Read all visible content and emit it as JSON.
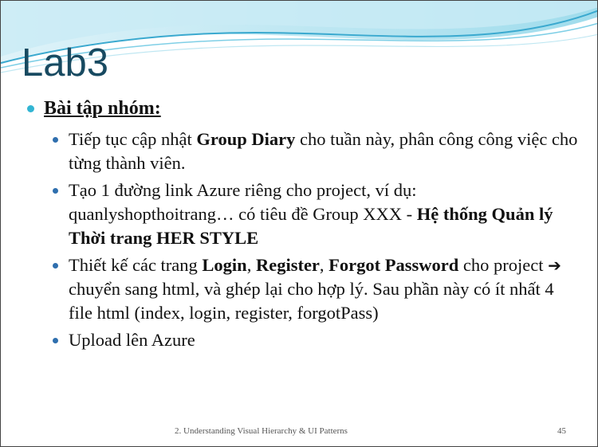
{
  "title": "Lab3",
  "section": {
    "label": "Bài tập nhóm:"
  },
  "bullets": [
    {
      "parts": [
        {
          "t": "Tiếp tục cập nhật "
        },
        {
          "t": "Group Diary",
          "b": true
        },
        {
          "t": " cho tuần này, phân công công việc cho từng thành viên."
        }
      ]
    },
    {
      "parts": [
        {
          "t": "Tạo 1 đường link Azure riêng cho project, ví dụ: quanlyshopthoitrang… có tiêu đề Group XXX - "
        },
        {
          "t": "Hệ thống Quản lý Thời trang HER STYLE",
          "b": true
        }
      ]
    },
    {
      "parts": [
        {
          "t": "Thiết kế các trang "
        },
        {
          "t": "Login",
          "b": true
        },
        {
          "t": ", "
        },
        {
          "t": "Register",
          "b": true
        },
        {
          "t": ", "
        },
        {
          "t": "Forgot Password",
          "b": true
        },
        {
          "t": " cho project "
        },
        {
          "t": "➔",
          "arrow": true
        },
        {
          "t": " chuyển sang html, và ghép lại cho hợp lý. Sau phần này có ít nhất 4 file html (index, login, register, forgotPass)"
        }
      ]
    },
    {
      "parts": [
        {
          "t": "Upload lên Azure"
        }
      ]
    }
  ],
  "footer": {
    "text": "2. Understanding Visual Hierarchy & UI Patterns",
    "page": "45"
  },
  "colors": {
    "title": "#184a61",
    "level1_bullet": "#32b5d3",
    "level2_bullet": "#2f6fae",
    "wave_light": "#bfe7f2",
    "wave_mid": "#7fcfe6",
    "wave_dark": "#3aa9cf"
  }
}
